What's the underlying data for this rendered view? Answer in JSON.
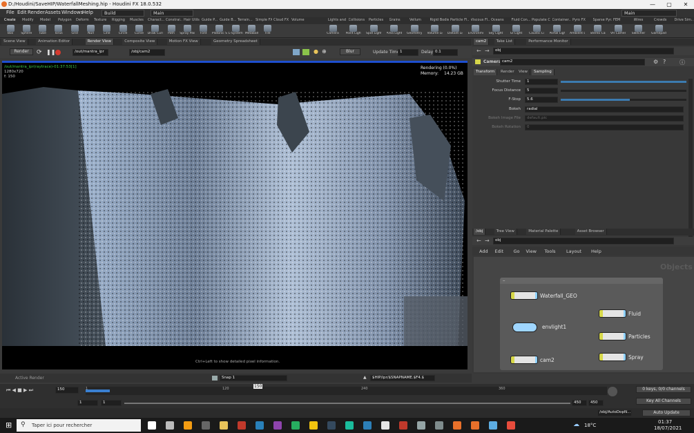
{
  "window": {
    "title": "D:/Houdini/SaveHIP/WaterfallMeshing.hip - Houdini FX 18.0.532",
    "controls": [
      "—",
      "▢",
      "✕"
    ]
  },
  "menu": {
    "items": [
      "File",
      "Edit",
      "Render",
      "Assets",
      "Windows",
      "Help"
    ],
    "desktop_left": "Build",
    "desktop_mid": "Main",
    "desktop_right": "Main"
  },
  "shelf_tabs_left": [
    "Create",
    "Modify",
    "Model",
    "Polygon",
    "Deform",
    "Texture",
    "Rigging",
    "Muscles",
    "Charact...",
    "Constrai...",
    "Hair Utils",
    "Guide P...",
    "Guide B...",
    "Terrain...",
    "Simple FX",
    "Cloud FX",
    "Volume"
  ],
  "shelf_tabs_right": [
    "Lights and ...",
    "Collisions",
    "Particles",
    "Grains",
    "Vellum",
    "Rigid Bodies",
    "Particle Fl...",
    "Viscous Fl...",
    "Oceans",
    "Fluid Con...",
    "Populate C...",
    "Container...",
    "Pyro FX",
    "Sparse Pyr...",
    "FEM",
    "Wires",
    "Crowds",
    "Drive Sim..."
  ],
  "tools_left": [
    "Box",
    "Sphere",
    "Tube",
    "Torus",
    "Grid",
    "Null",
    "Line",
    "Circle",
    "Curve",
    "Draw Curve",
    "Path",
    "Spray Paint",
    "Font",
    "Platonic Solids",
    "L-System",
    "Metaball",
    "File"
  ],
  "tools_right": [
    "Camera",
    "Point Light",
    "Spot Light",
    "Area Light",
    "Geometry Light",
    "Volume Light",
    "Distant Light",
    "Environment Light",
    "Sky Light",
    "GI Light",
    "Caustic Light",
    "Portal Light",
    "Ambient Light",
    "Stereo Camera",
    "VR Camera",
    "Switcher",
    "Gamepad Camera"
  ],
  "left_tabs": [
    "Scene View",
    "Animation Editor",
    "Render View",
    "Composite View",
    "Motion FX View",
    "Geometry Spreadsheet"
  ],
  "render_bar": {
    "render_label": "Render",
    "rop": "/out/mantra_ipr",
    "camera": "/obj/cam2",
    "blur_label": "Blur",
    "update_label": "Update Time",
    "update_value": "1",
    "delay_label": "Delay",
    "delay_value": "0.1"
  },
  "viewer": {
    "top_left": [
      "/out/mantra_ipr(raytrace)-01:37:53[1]",
      "1280x720",
      "f: 150"
    ],
    "status": "Rendering (0.0%)",
    "memory_label": "Memory:",
    "memory_value": "14.23 GB",
    "hint": "Ctrl+Left to show detailed pixel information.",
    "active_render": "Active Render",
    "snap_label": "Snap 1",
    "path_field": "$HIP/ipr/$SNAPNAME.$F4.$"
  },
  "right_tabs": [
    "cam2",
    "Take List",
    "Performance Monitor"
  ],
  "param": {
    "path": "obj",
    "node_type": "Camera",
    "node_name": "cam2",
    "tabs": [
      "Transform",
      "Render",
      "View",
      "Sampling"
    ],
    "rows": [
      {
        "label": "Shutter Time",
        "value": "1",
        "slider": 1.0
      },
      {
        "label": "Focus Distance",
        "value": "5",
        "slider": 0.0
      },
      {
        "label": "F-Stop",
        "value": "5.6",
        "slider": 0.55
      },
      {
        "label": "Bokeh",
        "value": "radial"
      },
      {
        "label": "Bokeh Image File",
        "value": "default.pic"
      },
      {
        "label": "Bokeh Rotation",
        "value": "0"
      }
    ]
  },
  "net_tabs": [
    "/obj",
    "Tree View",
    "Material Palette",
    "Asset Browser"
  ],
  "net": {
    "path": "obj",
    "menus": [
      "Add",
      "Edit",
      "Go",
      "View",
      "Tools",
      "Layout",
      "Help"
    ],
    "context": "Objects",
    "nodes": [
      {
        "name": "Waterfall_GEO"
      },
      {
        "name": "envlight1"
      },
      {
        "name": "cam2"
      },
      {
        "name": "Fluid"
      },
      {
        "name": "Particles"
      },
      {
        "name": "Spray"
      }
    ]
  },
  "timeline": {
    "frame": "150",
    "start": "1",
    "start2": "1",
    "end": "450",
    "end2": "450",
    "ticks": [
      "1",
      "120",
      "150",
      "240",
      "360"
    ],
    "keys_label": "0 keys, 0/0 channels",
    "key_all": "Key All Channels",
    "auto_update": "Auto Update",
    "path": "/obj/AutoDopN..."
  },
  "taskbar": {
    "search": "Taper ici pour rechercher",
    "temp": "18°C",
    "time": "01:37",
    "date": "18/07/2021"
  }
}
